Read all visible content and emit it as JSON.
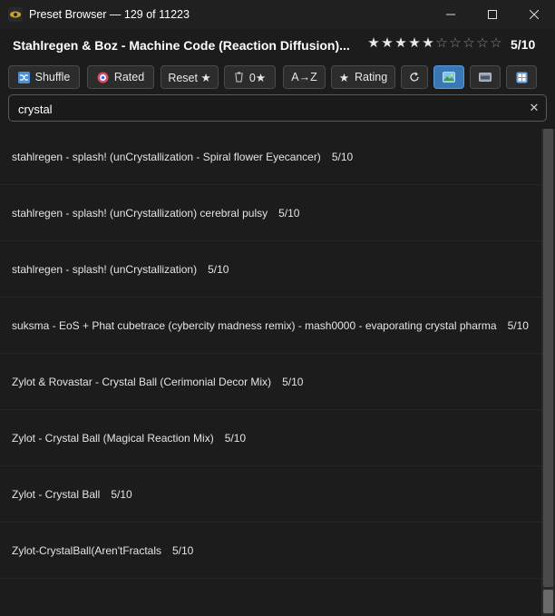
{
  "window": {
    "title": "Preset Browser — 129 of 11223",
    "controls": [
      "minimize",
      "maximize",
      "close"
    ]
  },
  "header": {
    "preset_name": "Stahlregen & Boz - Machine Code (Reaction Diffusion)...",
    "rating_value": 5,
    "rating_max": 10,
    "rating_text": "5/10"
  },
  "toolbar": {
    "shuffle": "Shuffle",
    "rated": "Rated",
    "reset": "Reset ★",
    "zero": "0★",
    "az": "A→Z",
    "rating": "Rating"
  },
  "search": {
    "value": "crystal",
    "placeholder": "",
    "clear": "✕"
  },
  "results": [
    {
      "name": "stahlregen - splash! (unCrystallization - Spiral flower Eyecancer)",
      "rating": "5/10"
    },
    {
      "name": "stahlregen - splash! (unCrystallization) cerebral pulsy",
      "rating": "5/10"
    },
    {
      "name": "stahlregen - splash! (unCrystallization)",
      "rating": "5/10"
    },
    {
      "name": "suksma - EoS + Phat cubetrace (cybercity madness remix) - mash0000 - evaporating crystal pharma",
      "rating": "5/10"
    },
    {
      "name": "Zylot & Rovastar - Crystal Ball (Cerimonial Decor Mix)",
      "rating": "5/10"
    },
    {
      "name": "Zylot - Crystal Ball (Magical Reaction Mix)",
      "rating": "5/10"
    },
    {
      "name": "Zylot - Crystal Ball",
      "rating": "5/10"
    },
    {
      "name": "Zylot-CrystalBall(Aren'tFractals",
      "rating": "5/10"
    }
  ],
  "colors": {
    "background": "#1c1c1c",
    "accent": "#3a78b5"
  }
}
